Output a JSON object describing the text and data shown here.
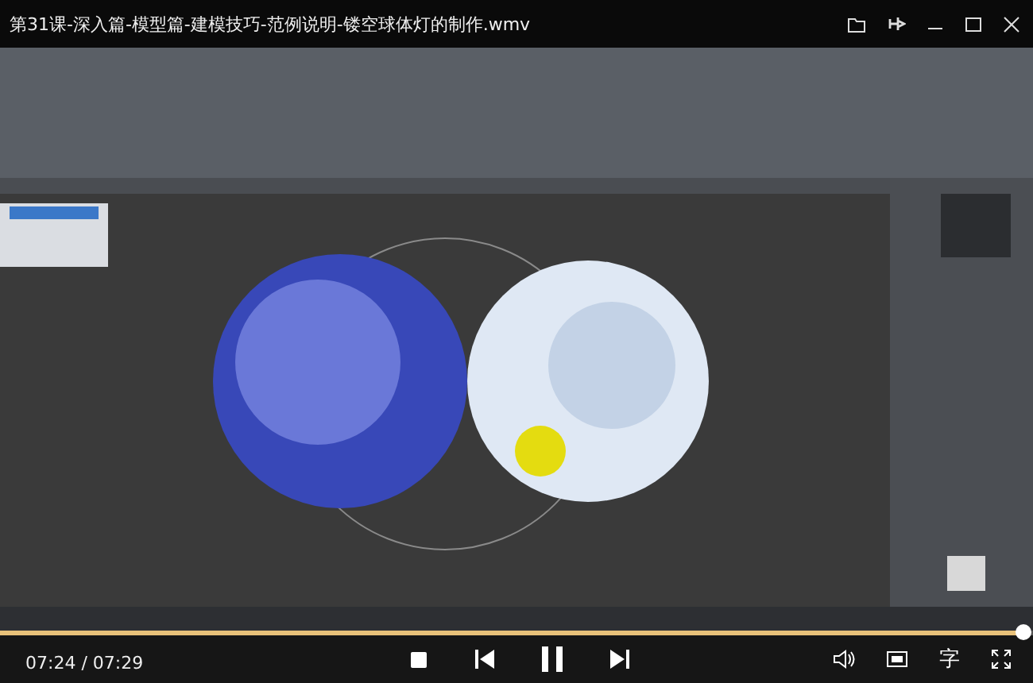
{
  "window": {
    "title": "第31课-深入篇-模型篇-建模技巧-范例说明-镂空球体灯的制作.wmv"
  },
  "progress": {
    "level": 0.99
  },
  "controls": {
    "time": "07:24 / 07:29",
    "playing": true,
    "subtitle_button": "字"
  }
}
